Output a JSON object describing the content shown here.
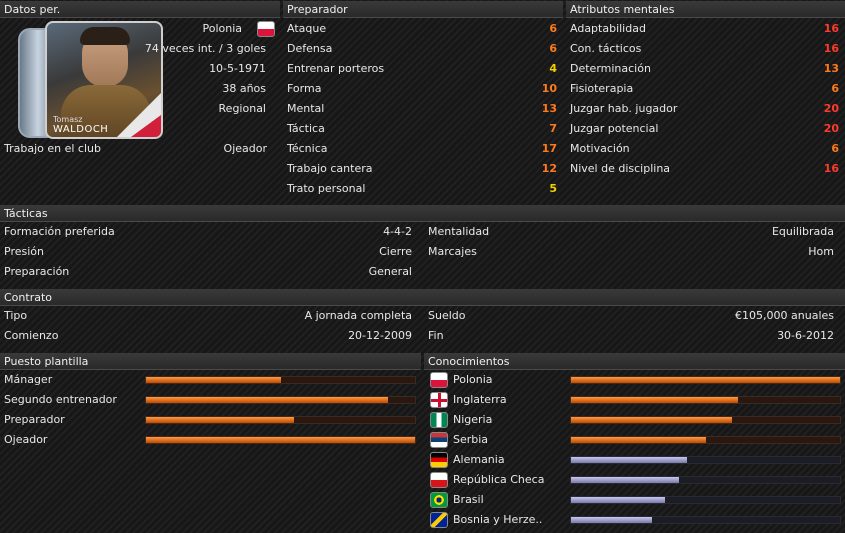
{
  "personal": {
    "header": "Datos per.",
    "nationality": "Polonia",
    "caps": "74 veces int. / 3 goles",
    "dob": "10-5-1971",
    "age": "38 años",
    "reputation": "Regional",
    "job_label": "Trabajo en el club",
    "job_value": "Ojeador",
    "photo_firstname": "Tomasz",
    "photo_lastname": "WALDOCH"
  },
  "coaching": {
    "header": "Preparador",
    "items": [
      {
        "label": "Ataque",
        "value": "6",
        "color": "#ff7a1a"
      },
      {
        "label": "Defensa",
        "value": "6",
        "color": "#ff7a1a"
      },
      {
        "label": "Entrenar porteros",
        "value": "4",
        "color": "#f0d000"
      },
      {
        "label": "Forma",
        "value": "10",
        "color": "#ff7a1a"
      },
      {
        "label": "Mental",
        "value": "13",
        "color": "#ff7a1a"
      },
      {
        "label": "Táctica",
        "value": "7",
        "color": "#ff7a1a"
      },
      {
        "label": "Técnica",
        "value": "17",
        "color": "#ff7a1a"
      },
      {
        "label": "Trabajo cantera",
        "value": "12",
        "color": "#ff7a1a"
      },
      {
        "label": "Trato personal",
        "value": "5",
        "color": "#f0d000"
      }
    ]
  },
  "mental": {
    "header": "Atributos mentales",
    "items": [
      {
        "label": "Adaptabilidad",
        "value": "16",
        "color": "#ff3a2a"
      },
      {
        "label": "Con. tácticos",
        "value": "16",
        "color": "#ff3a2a"
      },
      {
        "label": "Determinación",
        "value": "13",
        "color": "#ff7a1a"
      },
      {
        "label": "Fisioterapia",
        "value": "6",
        "color": "#ff7a1a"
      },
      {
        "label": "Juzgar hab. jugador",
        "value": "20",
        "color": "#ff3a2a"
      },
      {
        "label": "Juzgar potencial",
        "value": "20",
        "color": "#ff3a2a"
      },
      {
        "label": "Motivación",
        "value": "6",
        "color": "#ff7a1a"
      },
      {
        "label": "Nivel de disciplina",
        "value": "16",
        "color": "#ff3a2a"
      }
    ]
  },
  "tactics": {
    "header": "Tácticas",
    "formation_label": "Formación preferida",
    "formation_value": "4-4-2",
    "pressing_label": "Presión",
    "pressing_value": "Cierre",
    "prep_label": "Preparación",
    "prep_value": "General",
    "mentality_label": "Mentalidad",
    "mentality_value": "Equilibrada",
    "marking_label": "Marcajes",
    "marking_value": "Hom"
  },
  "contract": {
    "header": "Contrato",
    "type_label": "Tipo",
    "type_value": "A jornada completa",
    "start_label": "Comienzo",
    "start_value": "20-12-2009",
    "wage_label": "Sueldo",
    "wage_value": "€105,000 anuales",
    "end_label": "Fin",
    "end_value": "30-6-2012"
  },
  "roles": {
    "header": "Puesto plantilla",
    "items": [
      {
        "label": "Mánager",
        "fraction": 0.5
      },
      {
        "label": "Segundo entrenador",
        "fraction": 0.9
      },
      {
        "label": "Preparador",
        "fraction": 0.55
      },
      {
        "label": "Ojeador",
        "fraction": 1.0
      }
    ]
  },
  "knowledge": {
    "header": "Conocimientos",
    "items": [
      {
        "label": "Polonia",
        "fraction": 1.0,
        "kind": "orange",
        "flag_icon": "poland-flag-icon"
      },
      {
        "label": "Inglaterra",
        "fraction": 0.62,
        "kind": "orange",
        "flag_icon": "england-flag-icon"
      },
      {
        "label": "Nigeria",
        "fraction": 0.6,
        "kind": "orange",
        "flag_icon": "nigeria-flag-icon"
      },
      {
        "label": "Serbia",
        "fraction": 0.5,
        "kind": "orange",
        "flag_icon": "serbia-flag-icon"
      },
      {
        "label": "Alemania",
        "fraction": 0.43,
        "kind": "blue",
        "flag_icon": "germany-flag-icon"
      },
      {
        "label": "República Checa",
        "fraction": 0.4,
        "kind": "blue",
        "flag_icon": "czech-flag-icon"
      },
      {
        "label": "Brasil",
        "fraction": 0.35,
        "kind": "blue",
        "flag_icon": "brazil-flag-icon"
      },
      {
        "label": "Bosnia y Herze..",
        "fraction": 0.3,
        "kind": "blue",
        "flag_icon": "bosnia-flag-icon"
      }
    ]
  }
}
